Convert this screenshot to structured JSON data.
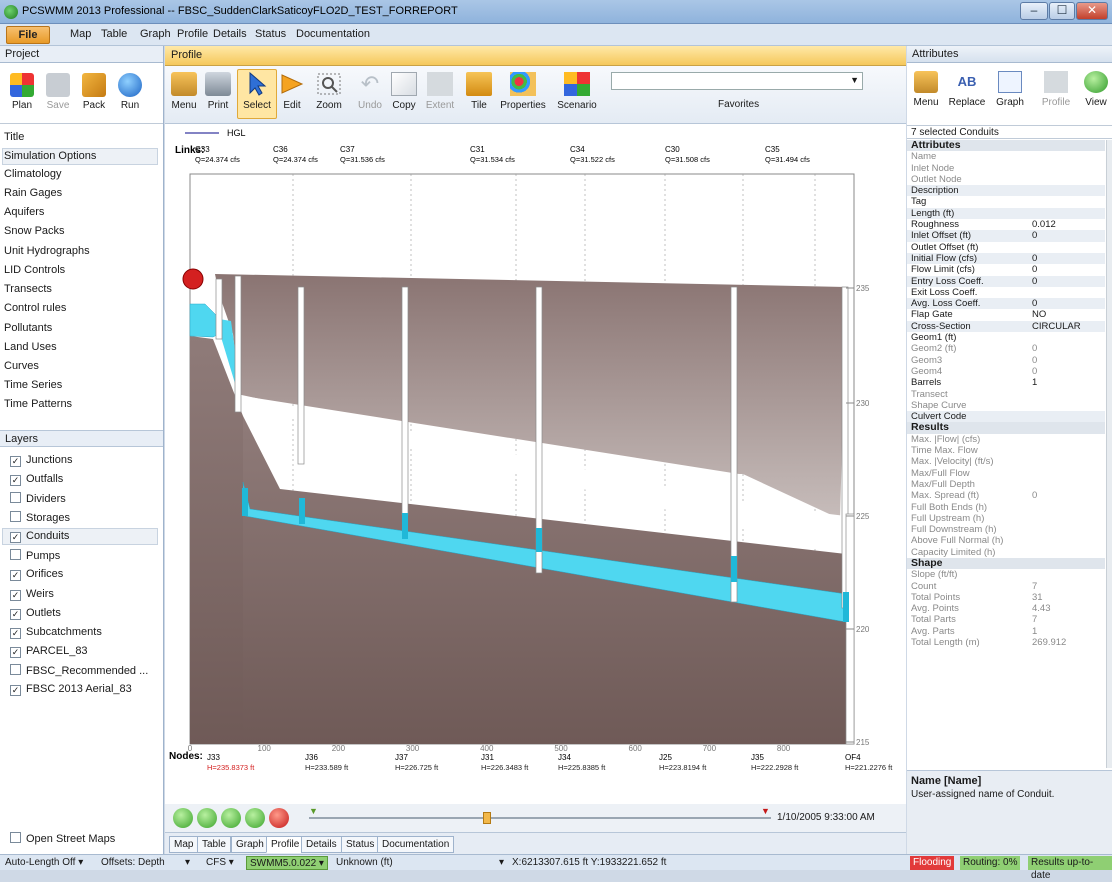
{
  "window": {
    "title": "PCSWMM 2013 Professional -- FBSC_SuddenClarkSaticoyFLO2D_TEST_FORREPORT",
    "btn_min": "–",
    "btn_max": "☐",
    "btn_close": "✕"
  },
  "menu": [
    "File",
    "Map",
    "Table",
    "Graph",
    "Profile",
    "Details",
    "Status",
    "Documentation"
  ],
  "project": {
    "header": "Project",
    "tools": [
      "Plan",
      "Save",
      "Pack",
      "Run"
    ],
    "items": [
      "Title",
      "Simulation Options",
      "Climatology",
      "Rain Gages",
      "Aquifers",
      "Snow Packs",
      "Unit Hydrographs",
      "LID Controls",
      "Transects",
      "Control rules",
      "Pollutants",
      "Land Uses",
      "Curves",
      "Time Series",
      "Time Patterns"
    ]
  },
  "layers": {
    "header": "Layers",
    "items": [
      {
        "label": "Junctions",
        "checked": true
      },
      {
        "label": "Outfalls",
        "checked": true
      },
      {
        "label": "Dividers",
        "checked": false
      },
      {
        "label": "Storages",
        "checked": false
      },
      {
        "label": "Conduits",
        "checked": true
      },
      {
        "label": "Pumps",
        "checked": false
      },
      {
        "label": "Orifices",
        "checked": true
      },
      {
        "label": "Weirs",
        "checked": true
      },
      {
        "label": "Outlets",
        "checked": true
      },
      {
        "label": "Subcatchments",
        "checked": true
      },
      {
        "label": "PARCEL_83",
        "checked": true
      },
      {
        "label": "FBSC_Recommended ...",
        "checked": false
      },
      {
        "label": "FBSC 2013 Aerial_83",
        "checked": true
      }
    ],
    "open_street_maps": "Open Street Maps"
  },
  "profile": {
    "tab": "Profile",
    "tools": [
      "Menu",
      "Print",
      "Select",
      "Edit",
      "Zoom",
      "Undo",
      "Copy",
      "Extent",
      "Tile",
      "Properties",
      "Scenario"
    ],
    "favorites": "Favorites",
    "legend": "HGL",
    "links_label": "Links:",
    "nodes_label": "Nodes:",
    "links": [
      {
        "name": "C33",
        "q": "Q=24.374 cfs"
      },
      {
        "name": "C36",
        "q": "Q=24.374 cfs"
      },
      {
        "name": "C37",
        "q": "Q=31.536 cfs"
      },
      {
        "name": "C31",
        "q": "Q=31.534 cfs"
      },
      {
        "name": "C34",
        "q": "Q=31.522 cfs"
      },
      {
        "name": "C30",
        "q": "Q=31.508 cfs"
      },
      {
        "name": "C35",
        "q": "Q=31.494 cfs"
      }
    ],
    "nodes": [
      {
        "name": "J33",
        "h": "H=235.8373 ft",
        "flood": true
      },
      {
        "name": "J36",
        "h": "H=233.589 ft",
        "flood": false
      },
      {
        "name": "J37",
        "h": "H=226.725 ft",
        "flood": false
      },
      {
        "name": "J31",
        "h": "H=226.3483 ft",
        "flood": false
      },
      {
        "name": "J34",
        "h": "H=225.8385 ft",
        "flood": false
      },
      {
        "name": "J25",
        "h": "H=223.8194 ft",
        "flood": false
      },
      {
        "name": "J35",
        "h": "H=222.2928 ft",
        "flood": false
      },
      {
        "name": "OF4",
        "h": "H=221.2276 ft",
        "flood": false
      }
    ],
    "x_ticks": [
      "0",
      "100",
      "200",
      "300",
      "400",
      "500",
      "600",
      "700",
      "800"
    ],
    "y_ticks": [
      "235",
      "230",
      "225",
      "220",
      "215"
    ],
    "timestamp": "1/10/2005 9:33:00 AM",
    "bottom_tabs": [
      "Map",
      "Table",
      "Graph",
      "Profile",
      "Details",
      "Status",
      "Documentation"
    ]
  },
  "attributes": {
    "header": "Attributes",
    "tools": [
      "Menu",
      "Replace",
      "Graph",
      "Profile",
      "View"
    ],
    "selection": "7 selected Conduits",
    "rows": [
      {
        "k": "Attributes",
        "v": "",
        "t": "sec"
      },
      {
        "k": "Name",
        "v": "",
        "t": "dim"
      },
      {
        "k": "Inlet Node",
        "v": "",
        "t": "dim"
      },
      {
        "k": "Outlet Node",
        "v": "",
        "t": "dim"
      },
      {
        "k": "Description",
        "v": "",
        "t": ""
      },
      {
        "k": "Tag",
        "v": "",
        "t": ""
      },
      {
        "k": "Length (ft)",
        "v": "",
        "t": ""
      },
      {
        "k": "Roughness",
        "v": "0.012",
        "t": ""
      },
      {
        "k": "Inlet Offset (ft)",
        "v": "0",
        "t": ""
      },
      {
        "k": "Outlet Offset (ft)",
        "v": "",
        "t": ""
      },
      {
        "k": "Initial Flow (cfs)",
        "v": "0",
        "t": ""
      },
      {
        "k": "Flow Limit (cfs)",
        "v": "0",
        "t": ""
      },
      {
        "k": "Entry Loss Coeff.",
        "v": "0",
        "t": ""
      },
      {
        "k": "Exit Loss Coeff.",
        "v": "",
        "t": ""
      },
      {
        "k": "Avg. Loss Coeff.",
        "v": "0",
        "t": ""
      },
      {
        "k": "Flap Gate",
        "v": "NO",
        "t": ""
      },
      {
        "k": "Cross-Section",
        "v": "CIRCULAR",
        "t": ""
      },
      {
        "k": "Geom1 (ft)",
        "v": "",
        "t": ""
      },
      {
        "k": "Geom2 (ft)",
        "v": "0",
        "t": "dim"
      },
      {
        "k": "Geom3",
        "v": "0",
        "t": "dim"
      },
      {
        "k": "Geom4",
        "v": "0",
        "t": "dim"
      },
      {
        "k": "Barrels",
        "v": "1",
        "t": ""
      },
      {
        "k": "Transect",
        "v": "",
        "t": "dim"
      },
      {
        "k": "Shape Curve",
        "v": "",
        "t": "dim"
      },
      {
        "k": "Culvert Code",
        "v": "",
        "t": ""
      },
      {
        "k": "Results",
        "v": "",
        "t": "sec"
      },
      {
        "k": "Max. |Flow| (cfs)",
        "v": "",
        "t": "dim"
      },
      {
        "k": "Time Max. Flow",
        "v": "",
        "t": "dim"
      },
      {
        "k": "Max. |Velocity| (ft/s)",
        "v": "",
        "t": "dim"
      },
      {
        "k": "Max/Full Flow",
        "v": "",
        "t": "dim"
      },
      {
        "k": "Max/Full Depth",
        "v": "",
        "t": "dim"
      },
      {
        "k": "Max. Spread (ft)",
        "v": "0",
        "t": "dim"
      },
      {
        "k": "Full Both Ends (h)",
        "v": "",
        "t": "dim"
      },
      {
        "k": "Full Upstream (h)",
        "v": "",
        "t": "dim"
      },
      {
        "k": "Full Downstream (h)",
        "v": "",
        "t": "dim"
      },
      {
        "k": "Above Full Normal (h)",
        "v": "",
        "t": "dim"
      },
      {
        "k": "Capacity Limited (h)",
        "v": "",
        "t": "dim"
      },
      {
        "k": "Shape",
        "v": "",
        "t": "sec"
      },
      {
        "k": "Slope (ft/ft)",
        "v": "",
        "t": "dim"
      },
      {
        "k": "Count",
        "v": "7",
        "t": "dim"
      },
      {
        "k": "Total Points",
        "v": "31",
        "t": "dim"
      },
      {
        "k": "Avg. Points",
        "v": "4.43",
        "t": "dim"
      },
      {
        "k": "Total Parts",
        "v": "7",
        "t": "dim"
      },
      {
        "k": "Avg. Parts",
        "v": "1",
        "t": "dim"
      },
      {
        "k": "Total Length (m)",
        "v": "269.912",
        "t": "dim"
      }
    ],
    "desc_title": "Name [Name]",
    "desc_text": "User-assigned name of Conduit."
  },
  "status": {
    "auto_length": "Auto-Length Off",
    "offsets": "Offsets: Depth",
    "units": "CFS",
    "engine": "SWMM5.0.022",
    "crs": "Unknown (ft)",
    "coords": "X:6213307.615 ft  Y:1933221.652 ft",
    "flooding": "Flooding",
    "routing": "Routing: 0%",
    "results": "Results up-to-date"
  },
  "colors": {
    "water": "#4fd7f0",
    "ground": "#8e7a78",
    "flood": "#d42020",
    "accent": "#f5c85c"
  }
}
